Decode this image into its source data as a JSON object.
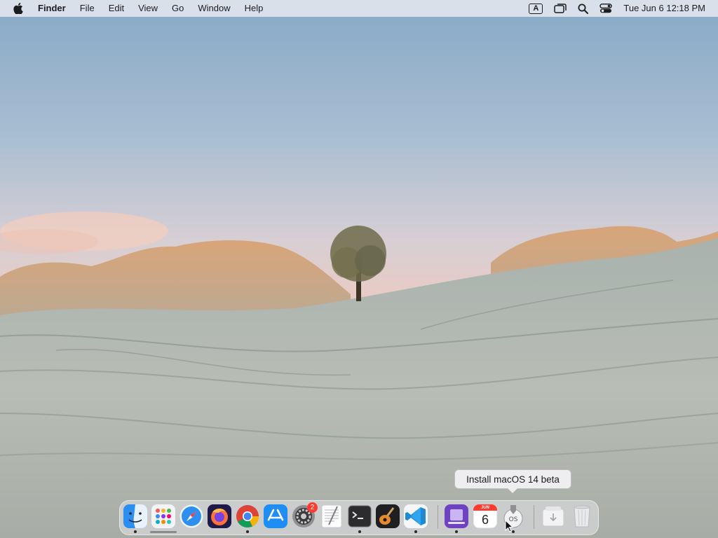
{
  "menubar": {
    "app_name": "Finder",
    "items": [
      "File",
      "Edit",
      "View",
      "Go",
      "Window",
      "Help"
    ],
    "input_indicator": "A",
    "clock": "Tue Jun 6  12:18 PM",
    "icons": [
      "apple-logo-icon",
      "input-source-icon",
      "screen-mirroring-icon",
      "spotlight-search-icon",
      "control-center-icon"
    ]
  },
  "tooltip": {
    "text": "Install macOS 14 beta"
  },
  "dock": {
    "apps": [
      {
        "name": "Finder",
        "icon": "finder-icon",
        "running": true
      },
      {
        "name": "Launchpad",
        "icon": "launchpad-icon",
        "running": false
      },
      {
        "name": "Safari",
        "icon": "safari-icon",
        "running": false
      },
      {
        "name": "Firefox",
        "icon": "firefox-icon",
        "running": false
      },
      {
        "name": "Google Chrome",
        "icon": "chrome-icon",
        "running": true
      },
      {
        "name": "App Store",
        "icon": "app-store-icon",
        "running": false
      },
      {
        "name": "System Settings",
        "icon": "system-settings-icon",
        "running": false,
        "badge": "2"
      },
      {
        "name": "TextEdit",
        "icon": "textedit-icon",
        "running": false
      },
      {
        "name": "Terminal",
        "icon": "terminal-icon",
        "running": true
      },
      {
        "name": "GarageBand",
        "icon": "garageband-icon",
        "running": false
      },
      {
        "name": "Visual Studio Code",
        "icon": "vscode-icon",
        "running": true
      },
      {
        "name": "Apple Configurator",
        "icon": "configurator-icon",
        "running": true
      },
      {
        "name": "Calendar",
        "icon": "calendar-icon",
        "running": false,
        "month": "JUN",
        "day": "6"
      },
      {
        "name": "Install macOS 14 beta",
        "icon": "install-macos-icon",
        "running": true
      },
      {
        "name": "Downloads",
        "icon": "downloads-stack-icon",
        "running": false
      },
      {
        "name": "Trash",
        "icon": "trash-icon",
        "running": false
      }
    ]
  },
  "colors": {
    "accent": "#1a7cf2",
    "badge": "#ff3b30",
    "menubar": "#ececf0"
  }
}
